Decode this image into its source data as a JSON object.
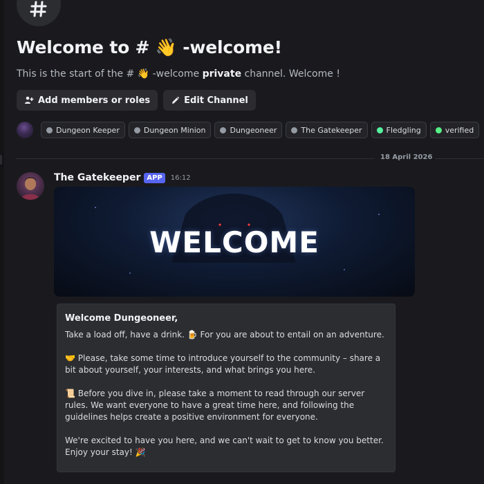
{
  "channel": {
    "icon": "hash-icon",
    "welcome_title": "Welcome to # 👋 -welcome!",
    "intro_prefix": "This is the start of the # 👋 -welcome ",
    "intro_bold": "private",
    "intro_suffix": " channel. Welcome !"
  },
  "actions": {
    "add_members_label": "Add members or roles",
    "edit_channel_label": "Edit Channel"
  },
  "roles": [
    {
      "label": "Dungeon Keeper",
      "color": "#949ba4"
    },
    {
      "label": "Dungeon Minion",
      "color": "#949ba4"
    },
    {
      "label": "Dungeoneer",
      "color": "#949ba4"
    },
    {
      "label": "The Gatekeeper",
      "color": "#949ba4"
    },
    {
      "label": "Fledgling",
      "color": "#57f2a0"
    },
    {
      "label": "verified",
      "color": "#57f287"
    }
  ],
  "date_divider": "18 April 2026",
  "message": {
    "author": "The Gatekeeper",
    "badge": "APP",
    "time": "16:12",
    "banner_text": "WELCOME",
    "embed": {
      "title": "Welcome Dungeoneer,",
      "paragraphs": [
        "Take a load off, have a drink. 🍺 For you are about to entail on an adventure.",
        "🤝 Please, take some time to introduce yourself to the community – share a bit about yourself, your interests, and what brings you here.",
        "📜 Before you dive in, please take a moment to read through our server rules. We want everyone to have a great time here, and following the guidelines helps create a positive environment for everyone.",
        "We're excited to have you here, and we can't wait to get to know you better. Enjoy your stay! 🎉"
      ]
    }
  }
}
